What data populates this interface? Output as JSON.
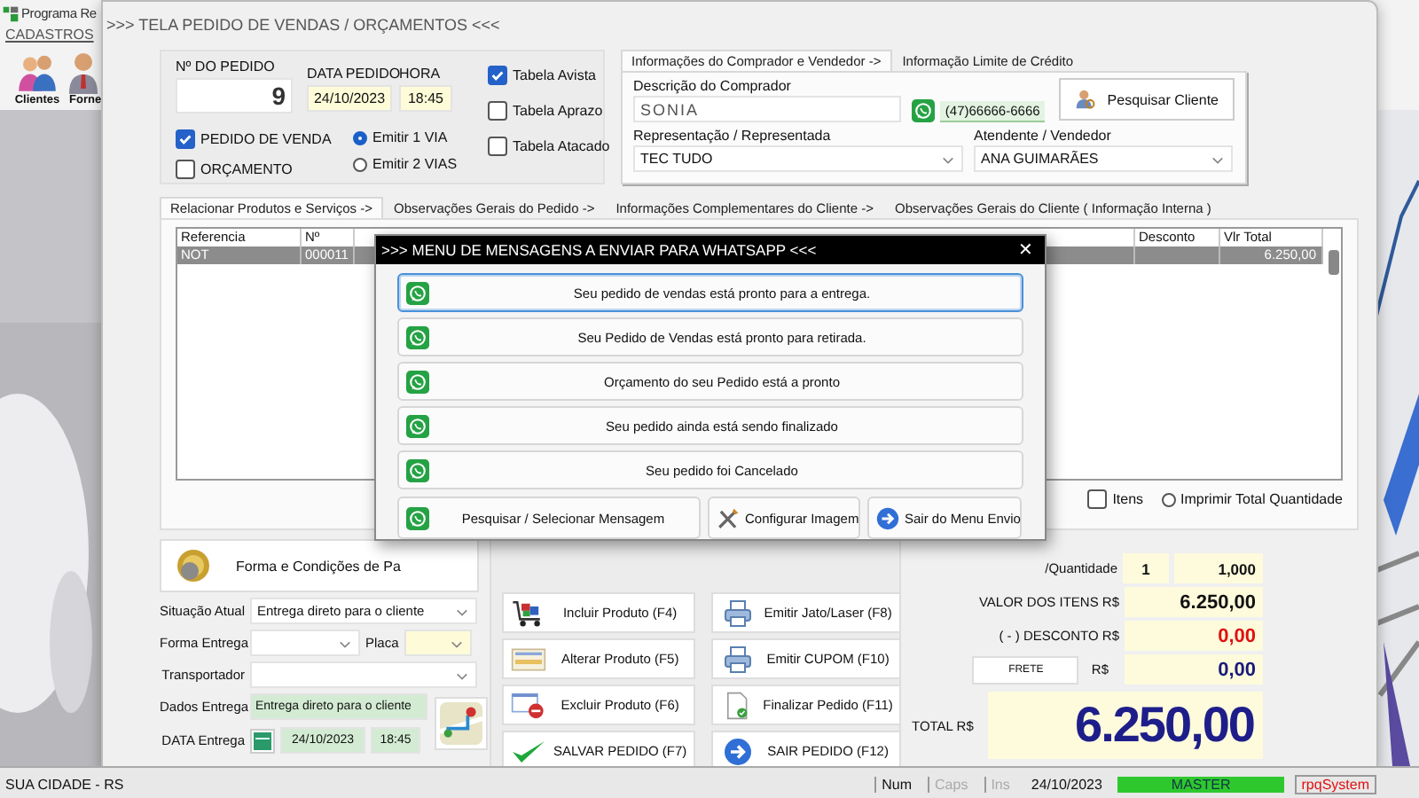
{
  "app": {
    "title": "Programa Re",
    "menu": [
      "CADASTROS"
    ],
    "toolbar": [
      {
        "label": "Clientes"
      },
      {
        "label": "Forne"
      }
    ]
  },
  "order_window": {
    "title": ">>> TELA PEDIDO DE VENDAS / ORÇAMENTOS <<<",
    "order": {
      "number_label": "Nº DO PEDIDO",
      "number": "9",
      "date_label": "DATA PEDIDO",
      "date": "24/10/2023",
      "time_label": "HORA",
      "time": "18:45"
    },
    "doc_types": [
      {
        "label": "PEDIDO DE VENDA",
        "checked": true
      },
      {
        "label": "ORÇAMENTO",
        "checked": false
      }
    ],
    "copies": [
      {
        "label": "Emitir 1 VIA",
        "selected": true
      },
      {
        "label": "Emitir 2 VIAS",
        "selected": false
      }
    ],
    "price_tables": [
      {
        "label": "Tabela Avista",
        "checked": true
      },
      {
        "label": "Tabela Aprazo",
        "checked": false
      },
      {
        "label": "Tabela Atacado",
        "checked": false
      }
    ],
    "buyer_tabs": [
      {
        "label": "Informações do Comprador e Vendedor ->",
        "selected": true
      },
      {
        "label": "Informação Limite de Crédito",
        "selected": false
      }
    ],
    "buyer": {
      "description_label": "Descrição do Comprador",
      "description": "SONIA",
      "phone": "(47)66666-6666",
      "search_button": "Pesquisar Cliente",
      "representation_label": "Representação / Representada",
      "representation": "TEC TUDO",
      "attendant_label": "Atendente / Vendedor",
      "attendant": "ANA GUIMARÃES"
    },
    "tabs": [
      {
        "label": "Relacionar Produtos e Serviços ->",
        "selected": true
      },
      {
        "label": "Observações Gerais do Pedido ->",
        "selected": false
      },
      {
        "label": "Informações Complementares do Cliente ->",
        "selected": false
      },
      {
        "label": "Observações Gerais do Cliente ( Informação Interna )",
        "selected": false
      }
    ],
    "table": {
      "columns": {
        "reference": "Referencia",
        "number": "Nº",
        "discount": "Desconto",
        "total": "Vlr Total"
      },
      "rows": [
        {
          "reference": "NOT",
          "number": "000011",
          "total": "6.250,00",
          "selected": true
        }
      ]
    },
    "options": [
      {
        "kind": "checkbox",
        "label": "Itens",
        "checked": false
      },
      {
        "kind": "radio",
        "label": "Imprimir Total Quantidade",
        "checked": false
      }
    ],
    "payment_button": "Forma e Condições de Pa",
    "delivery": {
      "status_label": "Situação Atual",
      "status": "Entrega direto para o cliente",
      "mode_label": "Forma Entrega",
      "plate_label": "Placa",
      "carrier_label": "Transportador",
      "data_label": "Dados Entrega",
      "data": "Entrega direto para o cliente",
      "date_label": "DATA Entrega",
      "date": "24/10/2023",
      "time": "18:45"
    },
    "actions": [
      {
        "label": "Incluir Produto  (F4)"
      },
      {
        "label": "Emitir Jato/Laser (F8)"
      },
      {
        "label": "Alterar Produto  (F5)"
      },
      {
        "label": "Emitir CUPOM   (F10)"
      },
      {
        "label": "Excluir Produto  (F6)"
      },
      {
        "label": "Finalizar Pedido  (F11)"
      },
      {
        "label": "SALVAR PEDIDO (F7)"
      },
      {
        "label": "SAIR  PEDIDO  (F12)"
      }
    ],
    "totals": {
      "quantity_label": "/Quantidade",
      "items_count": "1",
      "quantity": "1,000",
      "items_label": "VALOR DOS ITENS R$",
      "items_value": "6.250,00",
      "discount_label": "( - ) DESCONTO R$",
      "discount_value": "0,00",
      "freight_button": "FRETE",
      "freight_label": "R$",
      "freight_value": "0,00",
      "total_label": "TOTAL R$",
      "total_value": "6.250,00"
    }
  },
  "whatsapp_menu": {
    "title": ">>> MENU DE MENSAGENS A ENVIAR PARA WHATSAPP <<<",
    "close": "✕",
    "messages": [
      {
        "label": "Seu pedido de vendas está pronto para a entrega.",
        "selected": true
      },
      {
        "label": "Seu Pedido de Vendas está pronto para retirada.",
        "selected": false
      },
      {
        "label": "Orçamento do seu Pedido está a pronto",
        "selected": false
      },
      {
        "label": "Seu pedido ainda está sendo finalizado",
        "selected": false
      },
      {
        "label": "Seu pedido foi Cancelado",
        "selected": false
      }
    ],
    "buttons": [
      {
        "label": "Pesquisar / Selecionar Mensagem"
      },
      {
        "label": "Configurar Imagem"
      },
      {
        "label": "Sair do Menu Envio"
      }
    ]
  },
  "status_bar": {
    "location": "SUA CIDADE - RS",
    "keys": [
      {
        "label": "Num",
        "disabled": false
      },
      {
        "label": "Caps",
        "disabled": true
      },
      {
        "label": "Ins",
        "disabled": true
      }
    ],
    "date": "24/10/2023",
    "user": "MASTER",
    "brand": "rpqSystem"
  }
}
